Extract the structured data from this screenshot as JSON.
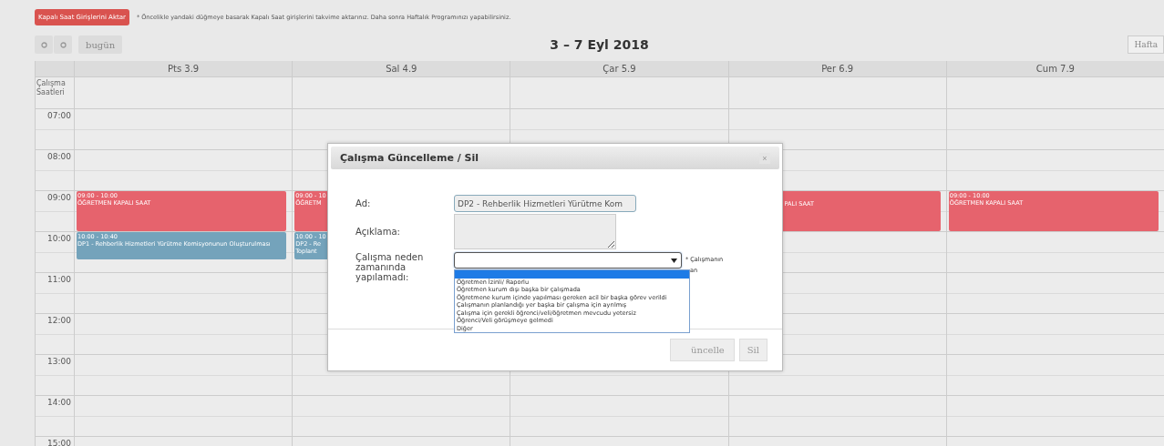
{
  "top_bar": {
    "import_button": "Kapalı Saat Girişlerini Aktar",
    "note": "* Öncelikle yandaki düğmeye basarak Kapalı Saat girişlerini takvime aktarınız. Daha sonra Haftalık Programınızı yapabilirsiniz."
  },
  "toolbar": {
    "today_button": "bugün",
    "title": "3 – 7 Eyl 2018",
    "view_button": "Hafta"
  },
  "calendar": {
    "all_day_label": "Çalışma Saatleri",
    "hours": [
      "07:00",
      "08:00",
      "09:00",
      "10:00",
      "11:00",
      "12:00",
      "13:00",
      "14:00",
      "15:00"
    ],
    "days": [
      {
        "label": "Pts 3.9",
        "events": [
          {
            "kind": "closed",
            "time": "09:00 - 10:00",
            "title": "ÖĞRETMEN KAPALI SAAT"
          },
          {
            "kind": "meeting",
            "time": "10:00 - 10:40",
            "title": "DP1 - Rehberlik Hizmetleri Yürütme Komisyonunun Oluşturulması"
          }
        ]
      },
      {
        "label": "Sal 4.9",
        "events": [
          {
            "kind": "closed",
            "time": "09:00 - 10",
            "title": "ÖĞRETM"
          },
          {
            "kind": "meeting",
            "time": "10:00 - 10",
            "title": "DP2 - Re",
            "extra": "Toplant"
          }
        ]
      },
      {
        "label": "Çar 5.9"
      },
      {
        "label": "Per 6.9",
        "events": [
          {
            "kind": "closed",
            "covered": true,
            "title": "PALI SAAT"
          }
        ]
      },
      {
        "label": "Cum 7.9",
        "events": [
          {
            "kind": "closed",
            "time": "09:00 - 10:00",
            "title": "ÖĞRETMEN KAPALI SAAT"
          }
        ]
      }
    ]
  },
  "dialog": {
    "title": "Çalışma Güncelleme / Sil",
    "close": "×",
    "fields": [
      {
        "kind": "input",
        "label": "Ad:",
        "value": "DP2 - Rehberlik Hizmetleri Yürütme Kom"
      },
      {
        "kind": "textarea",
        "label": "Açıklama:"
      },
      {
        "kind": "select",
        "label": "Çalışma neden zamanında yapılamadı:",
        "hint": [
          "* Çalışmanın",
          "an"
        ],
        "open": true,
        "blank_highlighted": true,
        "options": [
          {
            "label": "Öğretmen İzinli/ Raporlu",
            "selected": false
          },
          {
            "label": "Öğretmen kurum dışı başka bir çalışmada",
            "selected": false
          },
          {
            "label": "Öğretmene kurum içinde yapılması gereken acil bir başka görev verildi",
            "selected": false
          },
          {
            "label": "Çalışmanın planlandığı yer başka bir çalışma için ayrılmış",
            "selected": false
          },
          {
            "label": "Çalışma için gerekli öğrenci/veli/öğretmen mevcudu yetersiz",
            "selected": false
          },
          {
            "label": "Öğrenci/Veli görüşmeye gelmedi",
            "selected": false
          },
          {
            "label": "Diğer",
            "selected": false
          }
        ]
      }
    ],
    "buttons": [
      "üncelle",
      "Sil"
    ]
  }
}
